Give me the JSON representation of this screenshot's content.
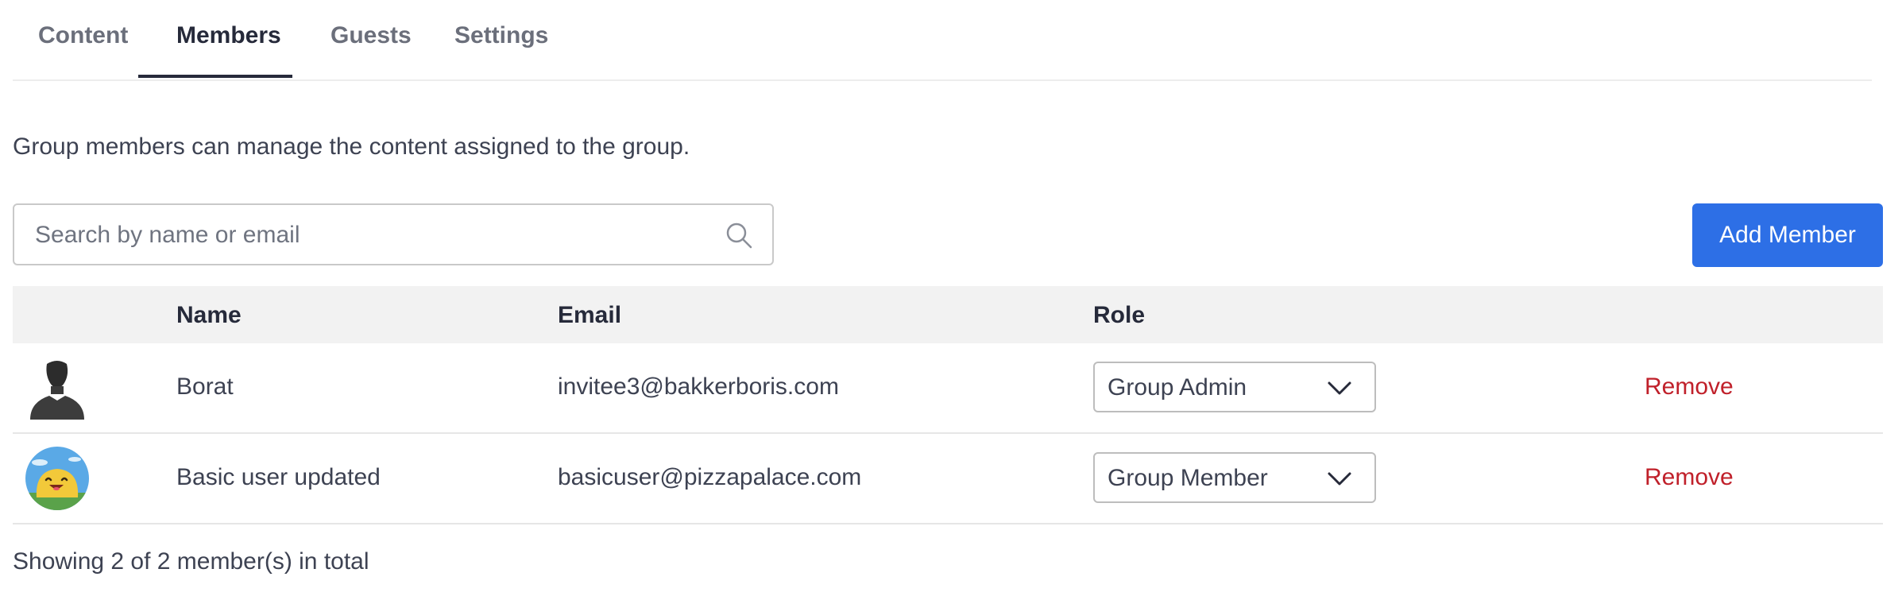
{
  "tabs": [
    {
      "label": "Content",
      "active": false
    },
    {
      "label": "Members",
      "active": true
    },
    {
      "label": "Guests",
      "active": false
    },
    {
      "label": "Settings",
      "active": false
    }
  ],
  "description": "Group members can manage the content assigned to the group.",
  "search": {
    "placeholder": "Search by name or email",
    "value": "",
    "icon": "search-icon"
  },
  "add_member_label": "Add Member",
  "colors": {
    "accent": "#2d6fe6",
    "danger": "#c0202a",
    "header_bg": "#f2f2f2"
  },
  "table": {
    "headers": {
      "name": "Name",
      "email": "Email",
      "role": "Role"
    },
    "rows": [
      {
        "avatar": "default-silhouette-avatar",
        "name": "Borat",
        "email": "invitee3@bakkerboris.com",
        "role": "Group Admin",
        "action": "Remove"
      },
      {
        "avatar": "smiley-blob-avatar",
        "name": "Basic user updated",
        "email": "basicuser@pizzapalace.com",
        "role": "Group Member",
        "action": "Remove"
      }
    ]
  },
  "footer": "Showing 2 of 2 member(s) in total"
}
